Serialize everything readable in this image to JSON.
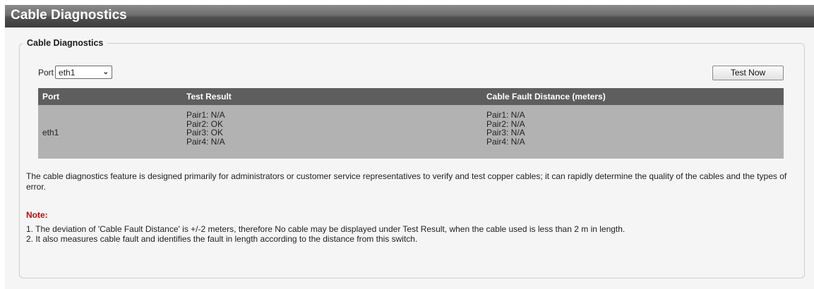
{
  "header": {
    "title": "Cable Diagnostics"
  },
  "panel": {
    "legend": "Cable Diagnostics",
    "port_label": "Port",
    "port_select_value": "eth1",
    "test_button": "Test Now"
  },
  "table": {
    "headers": [
      "Port",
      "Test Result",
      "Cable Fault Distance (meters)"
    ],
    "row": {
      "port": "eth1",
      "test_result": [
        "Pair1: N/A",
        "Pair2: OK",
        "Pair3: OK",
        "Pair4: N/A"
      ],
      "fault_distance": [
        "Pair1: N/A",
        "Pair2: N/A",
        "Pair3: N/A",
        "Pair4: N/A"
      ]
    }
  },
  "description": "The cable diagnostics feature is designed primarily for administrators or customer service representatives to verify and test copper cables; it can rapidly determine the quality of the cables and the types of error.",
  "note": {
    "title": "Note:",
    "items": [
      "1. The deviation of 'Cable Fault Distance' is +/-2 meters, therefore No cable may be displayed under Test Result, when the cable used is less than 2 m in length.",
      "2. It also measures cable fault and identifies the fault in length according to the distance from this switch."
    ]
  },
  "colors": {
    "title_bar": "#4f4f4f",
    "table_header": "#5e5e5e",
    "table_row": "#b2b2b2",
    "note_red": "#d10000"
  },
  "icons": {
    "select_arrow": "chevron-down-icon"
  }
}
